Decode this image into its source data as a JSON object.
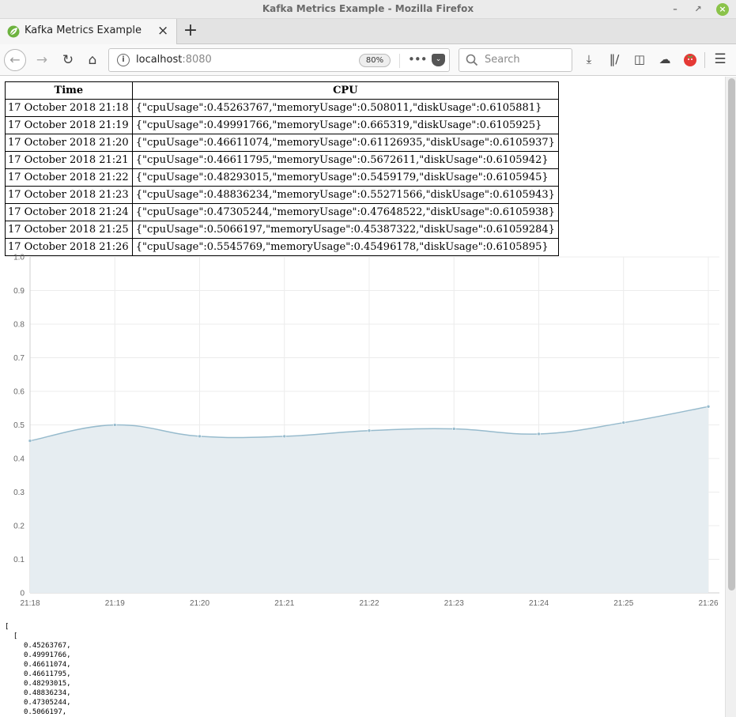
{
  "window": {
    "title": "Kafka Metrics Example - Mozilla Firefox"
  },
  "tab": {
    "title": "Kafka Metrics Example"
  },
  "urlbar": {
    "host": "localhost",
    "port": ":8080",
    "zoom": "80%"
  },
  "search": {
    "placeholder": "Search"
  },
  "table": {
    "headers": [
      "Time",
      "CPU"
    ],
    "rows": [
      {
        "time": "17 October 2018 21:18",
        "cpu": "{\"cpuUsage\":0.45263767,\"memoryUsage\":0.508011,\"diskUsage\":0.6105881}"
      },
      {
        "time": "17 October 2018 21:19",
        "cpu": "{\"cpuUsage\":0.49991766,\"memoryUsage\":0.665319,\"diskUsage\":0.6105925}"
      },
      {
        "time": "17 October 2018 21:20",
        "cpu": "{\"cpuUsage\":0.46611074,\"memoryUsage\":0.61126935,\"diskUsage\":0.6105937}"
      },
      {
        "time": "17 October 2018 21:21",
        "cpu": "{\"cpuUsage\":0.46611795,\"memoryUsage\":0.5672611,\"diskUsage\":0.6105942}"
      },
      {
        "time": "17 October 2018 21:22",
        "cpu": "{\"cpuUsage\":0.48293015,\"memoryUsage\":0.5459179,\"diskUsage\":0.6105945}"
      },
      {
        "time": "17 October 2018 21:23",
        "cpu": "{\"cpuUsage\":0.48836234,\"memoryUsage\":0.55271566,\"diskUsage\":0.6105943}"
      },
      {
        "time": "17 October 2018 21:24",
        "cpu": "{\"cpuUsage\":0.47305244,\"memoryUsage\":0.47648522,\"diskUsage\":0.6105938}"
      },
      {
        "time": "17 October 2018 21:25",
        "cpu": "{\"cpuUsage\":0.5066197,\"memoryUsage\":0.45387322,\"diskUsage\":0.61059284}"
      },
      {
        "time": "17 October 2018 21:26",
        "cpu": "{\"cpuUsage\":0.5545769,\"memoryUsage\":0.45496178,\"diskUsage\":0.6105895}"
      }
    ]
  },
  "chart_data": {
    "type": "area",
    "categories": [
      "21:18",
      "21:19",
      "21:20",
      "21:21",
      "21:22",
      "21:23",
      "21:24",
      "21:25",
      "21:26"
    ],
    "series": [
      {
        "values": [
          0.45263767,
          0.49991766,
          0.46611074,
          0.46611795,
          0.48293015,
          0.48836234,
          0.47305244,
          0.5066197,
          0.5545769
        ]
      }
    ],
    "y_ticks": [
      "0",
      "0.1",
      "0.2",
      "0.3",
      "0.4",
      "0.5",
      "0.6",
      "0.7",
      "0.8",
      "0.9",
      "1.0"
    ],
    "ylim": [
      0,
      1.0
    ],
    "grid": true,
    "title": "",
    "xlabel": "",
    "ylabel": "",
    "line_color": "#97bbcd",
    "fill_color": "#e6edf1"
  },
  "json_dump": {
    "open_outer": "[",
    "open_inner": "  [",
    "values": [
      "0.45263767,",
      "0.49991766,",
      "0.46611074,",
      "0.46611795,",
      "0.48293015,",
      "0.48836234,",
      "0.47305244,",
      "0.5066197,"
    ]
  },
  "colors": {
    "firefox_close": "#8bc34a",
    "extension_red": "#e53935"
  }
}
